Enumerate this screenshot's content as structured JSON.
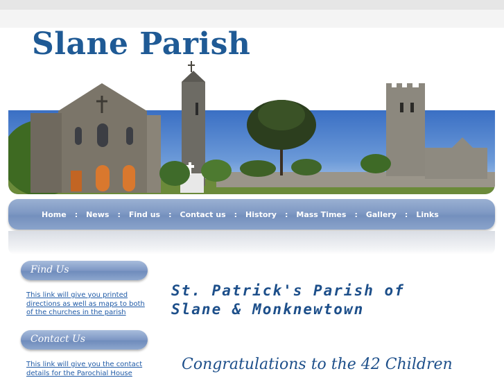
{
  "site": {
    "title": "Slane Parish"
  },
  "nav": {
    "items": [
      "Home",
      "News",
      "Find us",
      "Contact us",
      "History",
      "Mass Times",
      "Gallery",
      "Links"
    ],
    "separator": ":"
  },
  "sidebar": {
    "find_us": {
      "heading": "Find Us",
      "link": "This link will give you printed directions as well as maps to both of the churches in the parish"
    },
    "contact_us": {
      "heading": "Contact Us",
      "link": "This link will give you the contact details for the Parochial House"
    }
  },
  "main": {
    "heading_line1": "St. Patrick's Parish of",
    "heading_line2": "Slane & Monknewtown",
    "congrats": "Congratulations to the 42 Children"
  },
  "colors": {
    "title": "#1f5a95",
    "nav": "#7f99c4",
    "link": "#1f5aa6"
  }
}
